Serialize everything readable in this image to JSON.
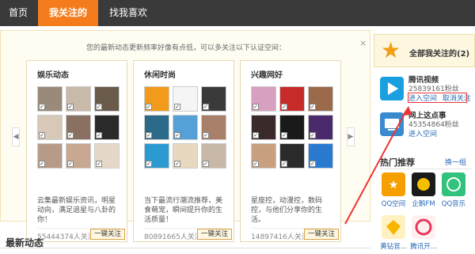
{
  "nav": {
    "tabs": [
      "首页",
      "我关注的",
      "找我喜欢"
    ]
  },
  "main": {
    "description": "您的最新动态更新频率好像有点低，可以多关注以下认证空间：",
    "close": "×",
    "cards": [
      {
        "title": "娱乐动态",
        "desc": "云集最新娱乐资讯，明星动向，满足追星与八卦的你！",
        "fans": "55444374人关注",
        "button": "一键关注",
        "thumbs": [
          "#9a8a7a",
          "#c9b9a9",
          "#6a5a4a",
          "#d8c8b8",
          "#8a7060",
          "#2a2a2a",
          "#b89a88",
          "#c8a890",
          "#e6d8c8"
        ]
      },
      {
        "title": "休闲时尚",
        "desc": "当下最流行潮流推荐，美食萌宠，瞬间提升你的生活质量！",
        "fans": "80891665人关注",
        "button": "一键关注",
        "thumbs": [
          "#f29a1a",
          "#f5f5f5",
          "#3a3a3a",
          "#2c6a8a",
          "#56a0d8",
          "#a8806a",
          "#2a9ad0",
          "#e8d8c0",
          "#c8b8a8"
        ]
      },
      {
        "title": "兴趣网好",
        "desc": "星座控，动漫控，数码控，与他们分享你的生活。",
        "fans": "14897416人关注",
        "button": "一键关注",
        "thumbs": [
          "#d8a0c0",
          "#c82a2a",
          "#9a6a4a",
          "#3a2a2a",
          "#1a1a1a",
          "#4a2a6a",
          "#c8a080",
          "#2a2a2a",
          "#2a7ad0"
        ]
      }
    ]
  },
  "latest": {
    "title": "最新动态"
  },
  "sidebar": {
    "all_follow": "全部我关注的(2)",
    "services": [
      {
        "name": "腾讯视频",
        "fans": "25839161粉丝",
        "enter": "进入空间",
        "unfollow": "取消关注",
        "color": "#1aa0e0"
      },
      {
        "name": "网上这点事",
        "fans": "45354864粉丝",
        "enter": "进入空间",
        "color": "#3a8ad0"
      }
    ],
    "hot": "热门推荐",
    "swap": "换一组",
    "recommendations": [
      {
        "label": "QQ空间",
        "color": "#f5a000"
      },
      {
        "label": "企鹅FM",
        "color": "#1a1a1a"
      },
      {
        "label": "QQ音乐",
        "color": "#31c27c"
      },
      {
        "label": "黄钻官...",
        "color": "#f7b500"
      },
      {
        "label": "腾讯开...",
        "color": "#e8365d"
      }
    ]
  },
  "colors": {
    "accent": "#f47c1c",
    "nav_bg": "#3a3a3a",
    "annotation_red": "#e33"
  }
}
